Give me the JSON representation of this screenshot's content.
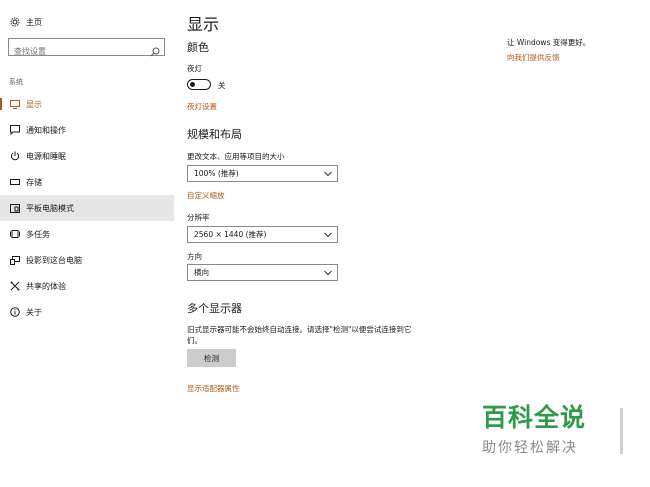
{
  "sidebar": {
    "home_label": "主页",
    "search_placeholder": "查找设置",
    "section": "系统",
    "items": [
      {
        "label": "显示",
        "icon": "monitor-icon"
      },
      {
        "label": "通知和操作",
        "icon": "message-icon"
      },
      {
        "label": "电源和睡眠",
        "icon": "power-icon"
      },
      {
        "label": "存储",
        "icon": "drive-icon"
      },
      {
        "label": "平板电脑模式",
        "icon": "tablet-icon"
      },
      {
        "label": "多任务",
        "icon": "multitask-icon"
      },
      {
        "label": "投影到这台电脑",
        "icon": "project-icon"
      },
      {
        "label": "共享的体验",
        "icon": "share-icon"
      },
      {
        "label": "关于",
        "icon": "info-icon"
      }
    ],
    "active_index": 0,
    "hover_index": 4
  },
  "main": {
    "title": "显示",
    "color_heading": "颜色",
    "night_light_label": "夜灯",
    "night_light_state": "关",
    "night_light_settings": "夜灯设置",
    "layout_heading": "规模和布局",
    "scale_label": "更改文本、应用等项目的大小",
    "scale_value": "100% (推荐)",
    "custom_scaling": "自定义缩放",
    "resolution_label": "分辨率",
    "resolution_value": "2560 × 1440 (推荐)",
    "orientation_label": "方向",
    "orientation_value": "横向",
    "multi_heading": "多个显示器",
    "multi_desc": "旧式显示器可能不会始终自动连接。请选择\"检测\"以便尝试连接到它们。",
    "detect_button": "检测",
    "adapter_link": "显示适配器属性"
  },
  "right": {
    "text": "让 Windows 变得更好。",
    "link": "向我们提供反馈"
  },
  "watermark": {
    "line1": "百科全说",
    "line2": "助你轻松解决"
  },
  "colors": {
    "accent": "#b35a1f",
    "watermark_green": "#2e9a4a"
  }
}
